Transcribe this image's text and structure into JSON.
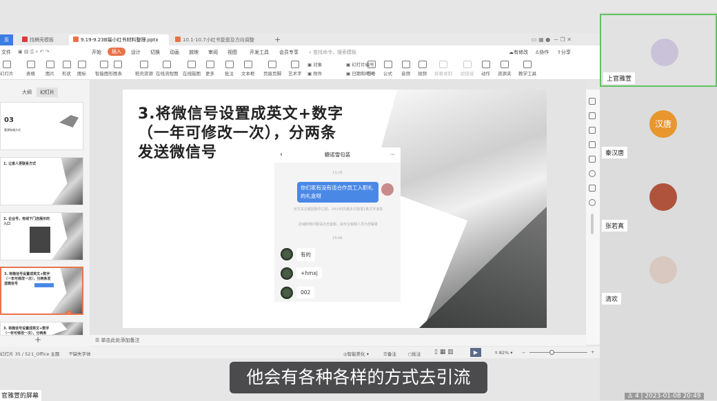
{
  "tabs": [
    {
      "label": "页"
    },
    {
      "label": "找稿壳模板"
    },
    {
      "label": "9.19-9.23B端小红书材料整理.pptx"
    },
    {
      "label": "10.1-10.7小红书复盘及方向调整"
    }
  ],
  "menu": [
    "文件",
    "开始",
    "插入",
    "设计",
    "切换",
    "动画",
    "放映",
    "审阅",
    "视图",
    "开发工具",
    "会员专享"
  ],
  "menu_active": "插入",
  "search_placeholder": "查找命令、搜索模板",
  "right_actions": [
    "有修改",
    "协作",
    "分享"
  ],
  "ribbon": [
    "幻灯片",
    "表格",
    "图片",
    "形状",
    "图标",
    "智能图形",
    "图表",
    "稻壳资源",
    "在线流程图",
    "在线脑图",
    "更多",
    "批注",
    "文本框",
    "页眉页脚",
    "艺术字",
    "对象",
    "附件",
    "幻灯片编号",
    "日期和时间",
    "符号",
    "公式",
    "音频",
    "视频",
    "屏幕录制",
    "超链接",
    "动作",
    "资源夹",
    "教学工具"
  ],
  "panel_tabs": [
    "大纲",
    "幻灯片"
  ],
  "thumbs": [
    {
      "num": "03",
      "title": "客源私域方式"
    },
    {
      "title": "1. 让客人更联系方式"
    },
    {
      "title": "2. 企业号，有线下门店展示的入口"
    },
    {
      "title": "3. 将微信号设置成英文+数字（一年可修改一次），分两条发送微信号"
    },
    {
      "title": "3. 将微信号设置成英文+数字（一年可修改一次），分两条"
    }
  ],
  "slide": {
    "title_lines": [
      "3.将微信号设置成英文+数字",
      "（一年可修改一次），分两条",
      "发送微信号"
    ],
    "chat": {
      "name": "糖诺雪包装",
      "time1": "11:16",
      "my_message": "你们家有没有适合作员工入职礼的礼盒呀",
      "notice1": "对方关注或回复你之前，24小时内最多只能发1条文字消息",
      "notice2": "店铺购物问题请点击客服，由专业客服人员为您解答",
      "time2": "15:06",
      "replies": [
        "有的",
        "+hmxj",
        "002"
      ]
    }
  },
  "notes_placeholder": "单击此处添加备注",
  "status": {
    "slide_count": "幻灯片 35 / 52",
    "theme": "1_Office 主题",
    "missing_font": "缺失字体",
    "beautify": "智能美化",
    "notes": "备注",
    "comment": "批注",
    "zoom": "82%"
  },
  "participants": [
    {
      "name": "上官雅萱",
      "active": true,
      "avatar_color": "#c9c2d8"
    },
    {
      "name": "秦汉唐",
      "avatar_text": "汉唐",
      "avatar_color": "#e8962e"
    },
    {
      "name": "张若真",
      "avatar_color": "#b0533c"
    },
    {
      "name": "清欢",
      "avatar_color": "#d8c8c0"
    }
  ],
  "subtitle": "他会有各种各样的方式去引流",
  "screen_label": "官雅萱的屏幕",
  "meeting_info": "4 | 2023-01-08 20:49"
}
